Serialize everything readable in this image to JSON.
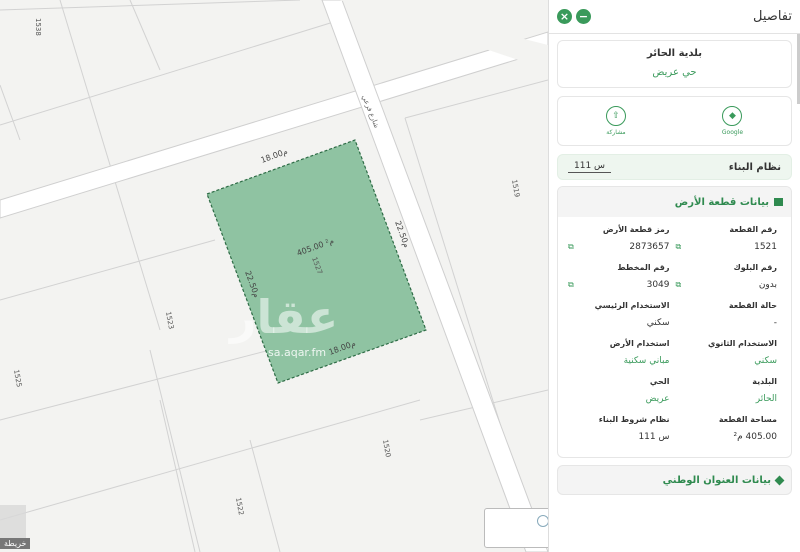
{
  "map": {
    "lot_numbers": [
      "1538",
      "1527",
      "1523",
      "1525",
      "1519",
      "1520",
      "1522"
    ],
    "dimensions": {
      "top": "18.00م",
      "right": "22.50م",
      "bottom": "18.00م",
      "left": "22.50م"
    },
    "area_label": "405.00 م²",
    "street_label": "شارع فرعي",
    "watermark": "عقار",
    "watermark_url": "sa.aqar.fm",
    "corner_label": "خريطة",
    "colors": {
      "parcel_fill": "#8fc3a2",
      "parcel_stroke": "#2d6b45",
      "road": "#ffffff",
      "line": "#cfcfcf"
    }
  },
  "panel": {
    "title": "تفاصيل",
    "close_icon": "close-icon",
    "minimize_icon": "minimize-icon",
    "municipality": "بلدية الحائر",
    "district": "حي عريض",
    "actions": [
      {
        "label": "Google",
        "icon": "map-pin-icon"
      },
      {
        "label": "مشاركة",
        "icon": "share-icon"
      }
    ],
    "building_system": {
      "label": "نظام البناء",
      "value": "س 111"
    },
    "lot_section": {
      "title": "بيانات قطعة الأرض",
      "fields": [
        {
          "key": "رقم القطعة",
          "value": "1521",
          "copy": true
        },
        {
          "key": "رمز قطعة الأرض",
          "value": "2873657",
          "copy": true
        },
        {
          "key": "رقم البلوك",
          "value": "بدون",
          "copy": true
        },
        {
          "key": "رقم المخطط",
          "value": "3049",
          "copy": true
        },
        {
          "key": "حالة القطعة",
          "value": "-",
          "copy": false
        },
        {
          "key": "الاستخدام الرئيسي",
          "value": "سكني",
          "copy": false
        },
        {
          "key": "الاستخدام الثانوي",
          "value": "سكني",
          "copy": false,
          "green": true
        },
        {
          "key": "استخدام الأرض",
          "value": "مباني سكنية",
          "copy": false,
          "green": true
        },
        {
          "key": "البلدية",
          "value": "الحائر",
          "copy": false,
          "green": true
        },
        {
          "key": "الحي",
          "value": "عريض",
          "copy": false,
          "green": true
        },
        {
          "key": "مساحة القطعة",
          "value": "405.00 م²",
          "copy": false
        },
        {
          "key": "نظام شروط البناء",
          "value": "س 111",
          "copy": false
        }
      ]
    },
    "address_section": {
      "title": "بيانات العنوان الوطني"
    },
    "accent": "#3a9a5b"
  }
}
